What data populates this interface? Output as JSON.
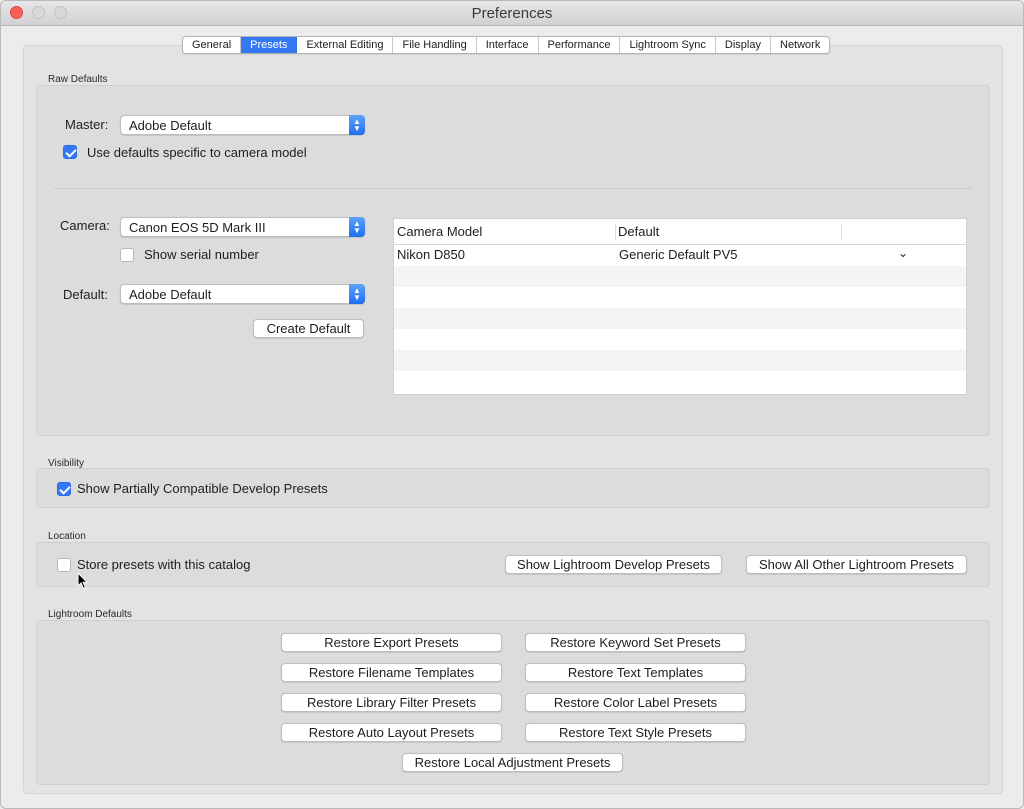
{
  "window": {
    "title": "Preferences"
  },
  "tabs": [
    "General",
    "Presets",
    "External Editing",
    "File Handling",
    "Interface",
    "Performance",
    "Lightroom Sync",
    "Display",
    "Network"
  ],
  "active_tab": "Presets",
  "raw_defaults": {
    "section_label": "Raw Defaults",
    "master_label": "Master:",
    "master_value": "Adobe Default",
    "use_camera_defaults_label": "Use defaults specific to camera model",
    "use_camera_defaults_checked": true,
    "camera_label": "Camera:",
    "camera_value": "Canon EOS 5D Mark III",
    "show_serial_label": "Show serial number",
    "show_serial_checked": false,
    "default_label": "Default:",
    "default_value": "Adobe Default",
    "create_default_button": "Create Default",
    "table": {
      "columns": [
        "Camera Model",
        "Default"
      ],
      "rows": [
        {
          "camera_model": "Nikon D850",
          "default": "Generic Default PV5"
        }
      ]
    }
  },
  "visibility": {
    "section_label": "Visibility",
    "show_partial_label": "Show Partially Compatible Develop Presets",
    "show_partial_checked": true
  },
  "location": {
    "section_label": "Location",
    "store_with_catalog_label": "Store presets with this catalog",
    "store_with_catalog_checked": false,
    "show_develop_button": "Show Lightroom Develop Presets",
    "show_all_other_button": "Show All Other Lightroom Presets"
  },
  "lightroom_defaults": {
    "section_label": "Lightroom Defaults",
    "buttons": [
      "Restore Export Presets",
      "Restore Keyword Set Presets",
      "Restore Filename Templates",
      "Restore Text Templates",
      "Restore Library Filter Presets",
      "Restore Color Label Presets",
      "Restore Auto Layout Presets",
      "Restore Text Style Presets",
      "Restore Local Adjustment Presets"
    ]
  },
  "colors": {
    "accent": "#3478f6",
    "close": "#fc5f57"
  }
}
